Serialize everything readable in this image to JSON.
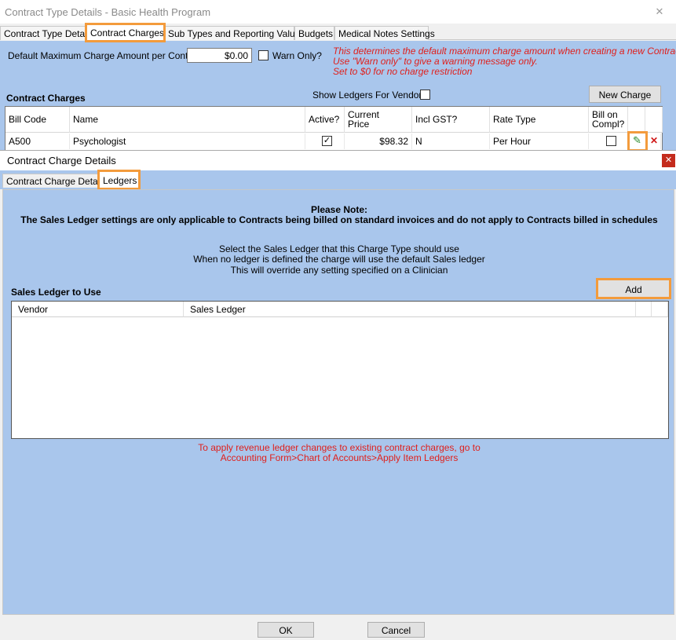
{
  "outer": {
    "title": "Contract Type Details - Basic Health Program",
    "close_glyph": "✕",
    "tabs": [
      "Contract Type Details",
      "Contract Charges",
      "Sub Types and Reporting Values",
      "Budgets",
      "Medical Notes Settings"
    ],
    "default_max_label": "Default Maximum Charge Amount per Contract",
    "default_max_value": "$0.00",
    "warn_only_label": "Warn Only?",
    "note_lines": [
      "This determines the default maximum charge amount when creating a new Contract.",
      "Use \"Warn only\" to give a warning message only.",
      "Set to $0 for no charge restriction"
    ],
    "section_title": "Contract Charges",
    "show_ledgers_label": "Show Ledgers For Vendor?",
    "new_charge_label": "New Charge",
    "grid": {
      "headers": [
        "Bill Code",
        "Name",
        "Active?",
        "Current\nPrice",
        "Incl GST?",
        "Rate Type",
        "Bill on\nCompl?"
      ],
      "row": {
        "bill_code": "A500",
        "name": "Psychologist",
        "active_glyph": "✓",
        "price": "$98.32",
        "incl_gst": "N",
        "rate_type": "Per Hour"
      },
      "edit_glyph": "✎",
      "delete_glyph": "✕"
    }
  },
  "inner": {
    "title": "Contract Charge Details",
    "close_glyph": "✕",
    "tabs": [
      "Contract Charge Details",
      "Ledgers"
    ],
    "note_title": "Please Note:",
    "note_body": "The Sales Ledger settings are only applicable to Contracts being billed on standard invoices and do not apply to Contracts billed in schedules",
    "info_lines": [
      "Select the Sales Ledger that this Charge Type should use",
      "When no ledger is defined the charge will use the default Sales ledger",
      "This will override any setting specified on a Clinician"
    ],
    "sales_ledger_title": "Sales Ledger to Use",
    "add_label": "Add",
    "ledger_headers": [
      "Vendor",
      "Sales Ledger"
    ],
    "footer_lines": [
      "To apply revenue ledger changes to existing contract charges, go to",
      "Accounting Form>Chart of Accounts>Apply Item Ledgers"
    ],
    "ok_label": "OK",
    "cancel_label": "Cancel"
  }
}
